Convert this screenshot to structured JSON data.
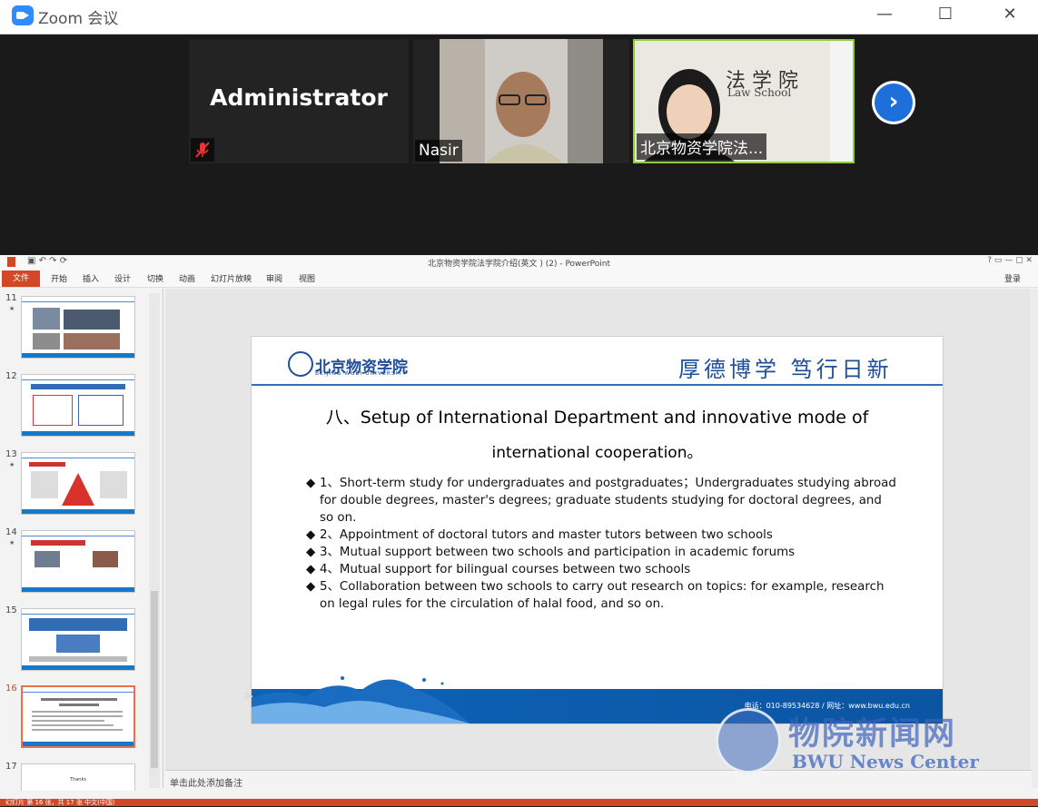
{
  "zoom": {
    "title": "Zoom 会议",
    "participants": [
      {
        "name": "Administrator",
        "muted": true
      },
      {
        "name": "Nasir"
      },
      {
        "name": "北京物资学院法..."
      }
    ],
    "bw_sign": "法 学 院",
    "bw_sign_en": "Law School"
  },
  "ppt": {
    "window_title": "北京物资学院法学院介绍(英文 ) (2) - PowerPoint",
    "file_tab": "文件",
    "tabs": [
      "开始",
      "插入",
      "设计",
      "切换",
      "动画",
      "幻灯片放映",
      "审阅",
      "视图"
    ],
    "login": "登录",
    "thumbnails": [
      {
        "num": "11",
        "star": "★"
      },
      {
        "num": "12",
        "star": ""
      },
      {
        "num": "13",
        "star": "★"
      },
      {
        "num": "14",
        "star": "★"
      },
      {
        "num": "15",
        "star": ""
      },
      {
        "num": "16",
        "star": "",
        "selected": true
      },
      {
        "num": "17",
        "star": "",
        "text": "Thanks"
      }
    ],
    "slide": {
      "logo_text": "北京物资学院",
      "logo_sub": "BEIJING WUZI UNIVERSITY",
      "motto": "厚德博学 笃行日新",
      "title_line1": "八、Setup of International Department and innovative mode of",
      "title_line2": "international cooperation。",
      "bullets": [
        "1、Short-term study for undergraduates and postgraduates；Undergraduates studying abroad for double degrees, master's degrees; graduate students studying for doctoral degrees, and so on.",
        "2、Appointment of doctoral tutors and master tutors between two schools",
        "3、Mutual support between two schools and participation in academic forums",
        "4、Mutual support for bilingual courses between two schools",
        "5、Collaboration between two schools to carry out research on topics: for example, research on legal rules for the circulation of halal food, and so on."
      ],
      "contact": "电话：010-89534628 / 网址：www.bwu.edu.cn"
    },
    "notes_placeholder": "单击此处添加备注",
    "status": "幻灯片 第 16 张，共 17 张   中文(中国)"
  },
  "watermark": {
    "cn": "物院新闻网",
    "en": "BWU News Center"
  },
  "colors": {
    "ppt_accent": "#d24726",
    "zoom_blue": "#2d8cff",
    "active_speaker": "#8fce3a",
    "slide_blue": "#1f4e9a"
  }
}
